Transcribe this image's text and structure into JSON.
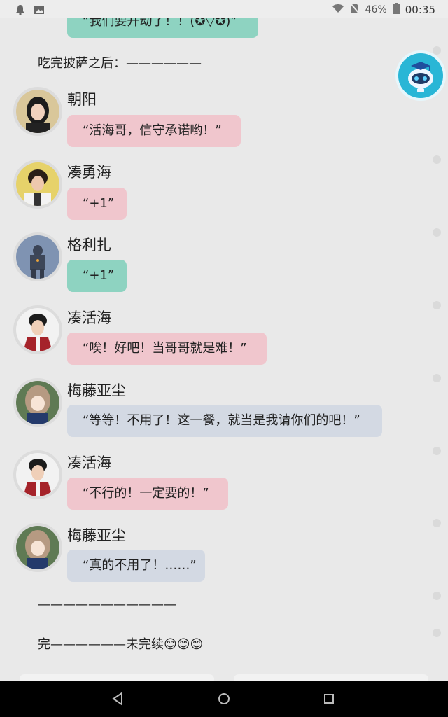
{
  "status_bar": {
    "battery": "46%",
    "time": "00:35",
    "icons": [
      "bell-icon",
      "image-icon",
      "wifi-icon",
      "no-sim-icon",
      "battery-icon"
    ]
  },
  "chat": {
    "top_partial_message": "“我们要开动了！！(✪▽✪)”",
    "narration_1": "吃完披萨之后：——————",
    "messages": [
      {
        "name": "朝阳",
        "text": "“活海哥，信守承诺哟！”",
        "color": "#f0c6cd"
      },
      {
        "name": "凑勇海",
        "text": "“+1”",
        "color": "#f0c6cd"
      },
      {
        "name": "格利扎",
        "text": "“+1”",
        "color": "#8ed3c1"
      },
      {
        "name": "凑活海",
        "text": "“唉！好吧！当哥哥就是难！”",
        "color": "#f0c6cd"
      },
      {
        "name": "梅藤亚尘",
        "text": "“等等！不用了！这一餐，就当是我请你们的吧！”",
        "color": "#d3d9e3"
      },
      {
        "name": "凑活海",
        "text": "“不行的！一定要的！”",
        "color": "#f0c6cd"
      },
      {
        "name": "梅藤亚尘",
        "text": "“真的不用了！……”",
        "color": "#d3d9e3"
      }
    ],
    "divider": "———————————",
    "ending": "完——————未完续😊😊😊"
  },
  "assistant": {
    "icon": "robot-assistant-icon"
  },
  "nav_bar": {
    "buttons": [
      "back-icon",
      "home-icon",
      "recents-icon"
    ]
  }
}
